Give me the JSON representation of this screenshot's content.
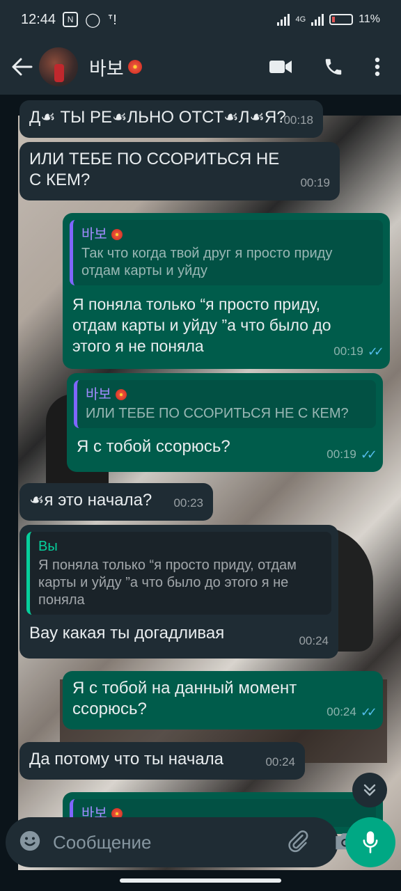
{
  "status_bar": {
    "time": "12:44",
    "network": "4G",
    "battery": "11%"
  },
  "header": {
    "contact_name": "바보",
    "icons": [
      "back-arrow-icon",
      "video-call-icon",
      "phone-icon",
      "more-vert-icon"
    ]
  },
  "messages": [
    {
      "dir": "in",
      "text": "Д☙ ТЫ РЕ☙ЛЬНО ОТСТ☙Л☙Я?",
      "time": "00:18"
    },
    {
      "dir": "in",
      "text": "ИЛИ ТЕБЕ ПО ССОРИТЬСЯ НЕ С КЕМ?",
      "time": "00:19"
    },
    {
      "dir": "out",
      "quote_author": "바보",
      "quote_text": "Так что когда твой друг я просто приду отдам карты и уйду",
      "text": "Я поняла только “я просто приду, отдам карты и уйду ”а что было до этого я не поняла",
      "time": "00:19",
      "status": "read"
    },
    {
      "dir": "out",
      "quote_author": "바보",
      "quote_text": "ИЛИ ТЕБЕ ПО ССОРИТЬСЯ НЕ С КЕМ?",
      "text": "Я с тобой ссорюсь?",
      "time": "00:19",
      "status": "read"
    },
    {
      "dir": "in",
      "text": "☙я это начала?",
      "time": "00:23"
    },
    {
      "dir": "in",
      "quote_author": "Вы",
      "quote_text": "Я поняла только “я просто приду, отдам карты и уйду ”а что было до этого я не поняла",
      "text": "Вау какая ты догадливая",
      "time": "00:24"
    },
    {
      "dir": "out",
      "text": "Я с тобой на данный момент ссорюсь?",
      "time": "00:24",
      "status": "read"
    },
    {
      "dir": "in",
      "text": "Да потому что ты начала",
      "time": "00:24"
    },
    {
      "dir": "out",
      "quote_author": "바보",
      "partial": true
    }
  ],
  "composer": {
    "placeholder": "Сообщение"
  },
  "colors": {
    "incoming": "#1f2c34",
    "outgoing": "#005c4b",
    "accent": "#00a884",
    "read_ticks": "#53bdeb"
  }
}
